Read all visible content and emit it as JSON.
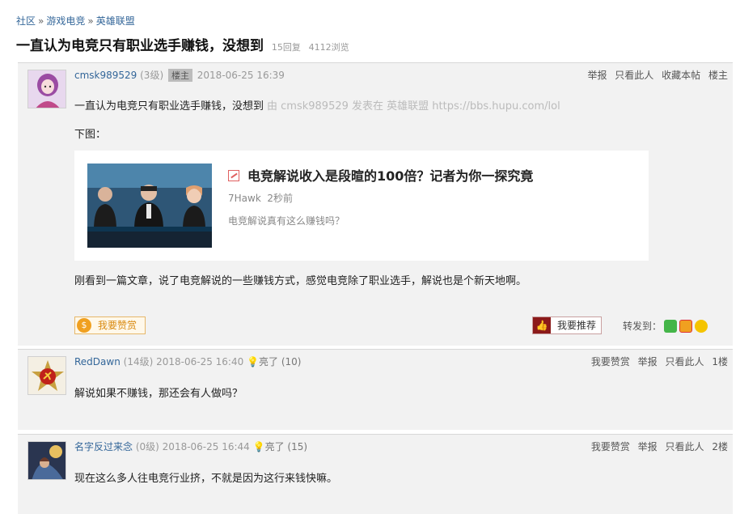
{
  "breadcrumb": {
    "community": "社区",
    "sep1": "»",
    "board": "游戏电竞",
    "sep2": "»",
    "subboard": "英雄联盟"
  },
  "thread": {
    "title": "一直认为电竞只有职业选手赚钱，没想到",
    "replies": "15回复",
    "views": "4112浏览"
  },
  "main_post": {
    "username": "cmsk989529",
    "level": "(3级)",
    "owner_badge": "楼主",
    "time": "2018-06-25 16:39",
    "actions": {
      "report": "举报",
      "only_this_user": "只看此人",
      "favorite": "收藏本帖",
      "floor": "楼主"
    },
    "line1": "一直认为电竞只有职业选手赚钱，没想到",
    "via": "由 cmsk989529 发表在 英雄联盟 https://bbs.hupu.com/lol",
    "line2": "下图：",
    "card": {
      "title": "电竞解说收入是段暄的100倍？记者为你一探究竟",
      "author": "7Hawk",
      "age": "2秒前",
      "desc": "电竞解说真有这么赚钱吗？"
    },
    "line3": "刚看到一篇文章，说了电竞解说的一些赚钱方式，感觉电竞除了职业选手，解说也是个新天地啊。",
    "reward_label": "我要赞赏",
    "recommend_label": "我要推荐",
    "share_label": "转发到："
  },
  "replies": [
    {
      "username": "RedDawn",
      "level": "(14级)",
      "time": "2018-06-25 16:40",
      "likes": "亮了 (10)",
      "actions": {
        "reward": "我要赞赏",
        "report": "举报",
        "only_this_user": "只看此人",
        "floor": "1楼"
      },
      "content": "解说如果不赚钱，那还会有人做吗？"
    },
    {
      "username": "名字反过来念",
      "level": "(0级)",
      "time": "2018-06-25 16:44",
      "likes": "亮了 (15)",
      "actions": {
        "reward": "我要赞赏",
        "report": "举报",
        "only_this_user": "只看此人",
        "floor": "2楼"
      },
      "content": "现在这么多人往电竞行业挤，不就是因为这行来钱快嘛。"
    }
  ],
  "colors": {
    "link": "#336699",
    "panel": "#f2f2f2",
    "reward": "#d98a10",
    "recommend": "#8b1a1a"
  },
  "icons": [
    "bulb-icon",
    "coin-icon",
    "thumbs-up-icon",
    "wechat-icon",
    "weibo-icon",
    "qzone-icon"
  ]
}
